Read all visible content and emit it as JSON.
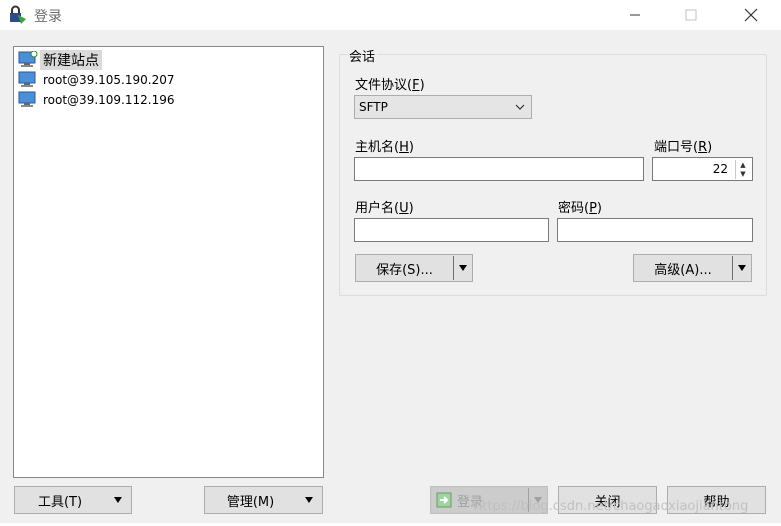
{
  "window": {
    "title": "登录"
  },
  "tree": {
    "items": [
      {
        "label": "新建站点",
        "icon": "new-site-icon"
      },
      {
        "label": "root@39.105.190.207",
        "icon": "computer-icon"
      },
      {
        "label": "root@39.109.112.196",
        "icon": "computer-icon"
      }
    ]
  },
  "session": {
    "group_title": "会话",
    "protocol_label_pre": "文件协议(",
    "protocol_label_key": "F",
    "protocol_label_post": ")",
    "protocol_value": "SFTP",
    "host_label_pre": "主机名(",
    "host_label_key": "H",
    "host_label_post": ")",
    "host_value": "",
    "port_label_pre": "端口号(",
    "port_label_key": "R",
    "port_label_post": ")",
    "port_value": "22",
    "user_label_pre": "用户名(",
    "user_label_key": "U",
    "user_label_post": ")",
    "user_value": "",
    "password_label_pre": "密码(",
    "password_label_key": "P",
    "password_label_post": ")",
    "password_value": "",
    "save_label": "保存(S)...",
    "advanced_label": "高级(A)..."
  },
  "footer": {
    "tools_label": "工具(T)",
    "manage_label": "管理(M)",
    "login_label": "登录",
    "close_label": "关闭",
    "help_label": "帮助"
  },
  "watermark": "https://blog.csdn.net/chaogaoxiaojiantong"
}
